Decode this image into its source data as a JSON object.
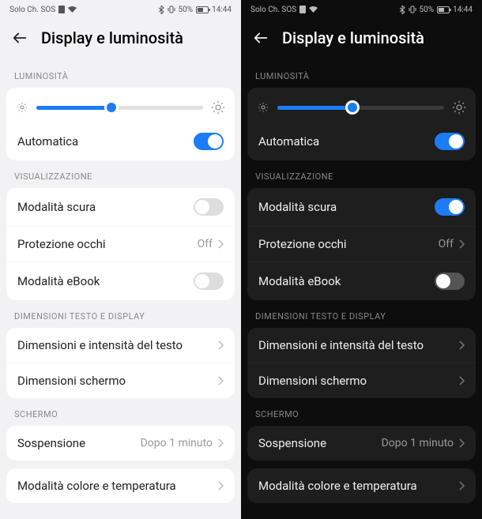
{
  "status": {
    "left": "Solo Ch. SOS",
    "battery_pct": "50%",
    "time": "14:44"
  },
  "header": {
    "title": "Display e luminosità"
  },
  "brightness": {
    "section": "LUMINOSITÀ",
    "percent": 45,
    "auto_label": "Automatica",
    "auto_on": true
  },
  "visual": {
    "section": "VISUALIZZAZIONE",
    "dark_mode_label": "Modalità scura",
    "eye_label": "Protezione occhi",
    "eye_value": "Off",
    "ebook_label": "Modalità eBook"
  },
  "text": {
    "section": "DIMENSIONI TESTO E DISPLAY",
    "size_label": "Dimensioni e intensità del testo",
    "screen_label": "Dimensioni schermo"
  },
  "screen": {
    "section": "SCHERMO",
    "sleep_label": "Sospensione",
    "sleep_value": "Dopo 1 minuto",
    "color_label": "Modalità colore e temperatura"
  },
  "panes": {
    "light": {
      "dark_mode_on": false,
      "ebook_on": false
    },
    "dark": {
      "dark_mode_on": true,
      "ebook_on": false
    }
  }
}
